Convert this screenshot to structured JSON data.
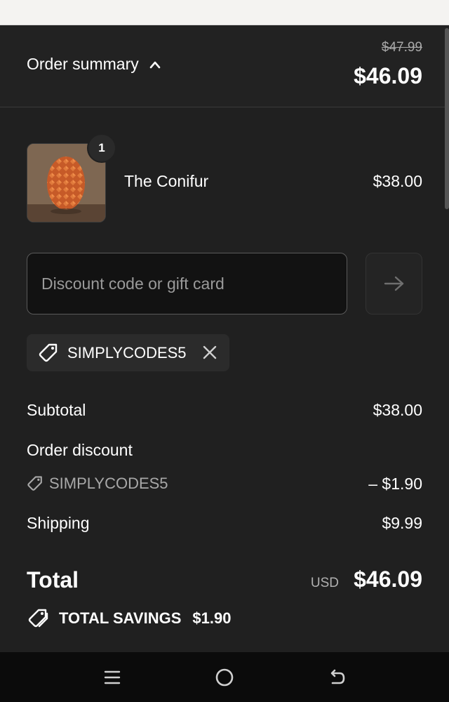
{
  "summary": {
    "toggle_label": "Order summary",
    "original_price": "$47.99",
    "total_price": "$46.09"
  },
  "cart": {
    "items": [
      {
        "name": "The Conifur",
        "quantity": "1",
        "price": "$38.00"
      }
    ]
  },
  "discount": {
    "placeholder": "Discount code or gift card",
    "value": "",
    "applied_code": "SIMPLYCODES5"
  },
  "totals": {
    "subtotal_label": "Subtotal",
    "subtotal_value": "$38.00",
    "order_discount_label": "Order discount",
    "order_discount_code": "SIMPLYCODES5",
    "order_discount_value": "– $1.90",
    "shipping_label": "Shipping",
    "shipping_value": "$9.99",
    "total_label": "Total",
    "currency": "USD",
    "total_value": "$46.09",
    "savings_label": "TOTAL SAVINGS",
    "savings_value": "$1.90"
  },
  "icons": {
    "chevron": "chevron-up-icon",
    "arrow": "arrow-right-icon",
    "tag": "tag-icon",
    "close": "close-icon",
    "nav_menu": "menu-icon",
    "nav_home": "home-icon",
    "nav_back": "back-icon"
  },
  "colors": {
    "background": "#202020",
    "text": "#ffffff",
    "muted": "#a8a8a8",
    "input_bg": "#121212",
    "nav_bg": "#0b0b0b"
  }
}
